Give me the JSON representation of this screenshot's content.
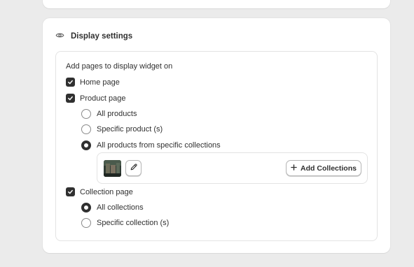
{
  "card": {
    "title": "Display settings",
    "icon": "eye-icon"
  },
  "section": {
    "lead": "Add pages to display widget on",
    "home_page": {
      "label": "Home page",
      "checked": true
    },
    "product_page": {
      "label": "Product page",
      "checked": true,
      "options": [
        {
          "label": "All products",
          "selected": false
        },
        {
          "label": "Specific product (s)",
          "selected": false
        },
        {
          "label": "All products from specific collections",
          "selected": true
        }
      ]
    },
    "collections_picker": {
      "add_button_label": "Add Collections",
      "edit_icon": "pencil-icon",
      "add_icon": "plus-icon"
    },
    "collection_page": {
      "label": "Collection page",
      "checked": true,
      "options": [
        {
          "label": "All collections",
          "selected": true
        },
        {
          "label": "Specific collection (s)",
          "selected": false
        }
      ]
    }
  }
}
